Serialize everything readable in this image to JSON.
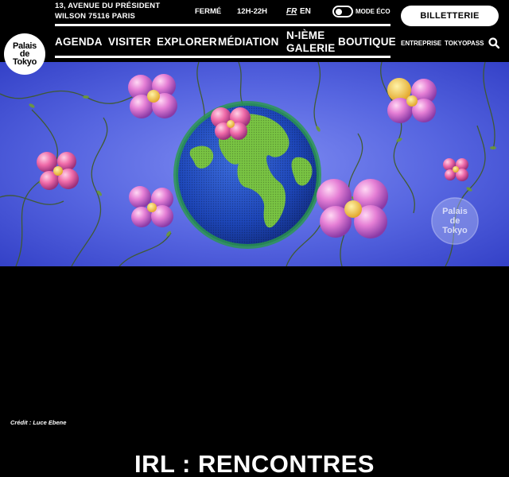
{
  "header": {
    "address_line1": "13, AVENUE DU PRÉSIDENT",
    "address_line2": "WILSON 75116 PARIS",
    "status": "FERMÉ",
    "hours": "12H-22H",
    "lang_fr": "FR",
    "lang_en": "EN",
    "eco_label": "MODE ÉCO",
    "eco_mode_on": false,
    "ticket_label": "BILLETTERIE",
    "logo_lines": [
      "Palais",
      "de",
      "Tokyo"
    ]
  },
  "nav": {
    "agenda": "AGENDA",
    "visiter": "VISITER",
    "explorer": "EXPLORER",
    "mediation": "MÉDIATION",
    "galerie_line1": "N-IÈME",
    "galerie_line2": "GALERIE",
    "boutique": "BOUTIQUE",
    "entreprise": "ENTREPRISE",
    "tokyopass": "TOKYOPASS"
  },
  "hero": {
    "watermark_lines": [
      "Palais",
      "de",
      "Tokyo"
    ],
    "icons": [
      "globe",
      "flower",
      "vine"
    ]
  },
  "credit": "Crédit : Luce Ebene",
  "page_title": "IRL : RENCONTRES",
  "colors": {
    "background": "#000000",
    "text": "#ffffff",
    "hero_blue": "#5564e0",
    "globe_green": "#7cc646",
    "flower_pink": "#d068c8"
  }
}
